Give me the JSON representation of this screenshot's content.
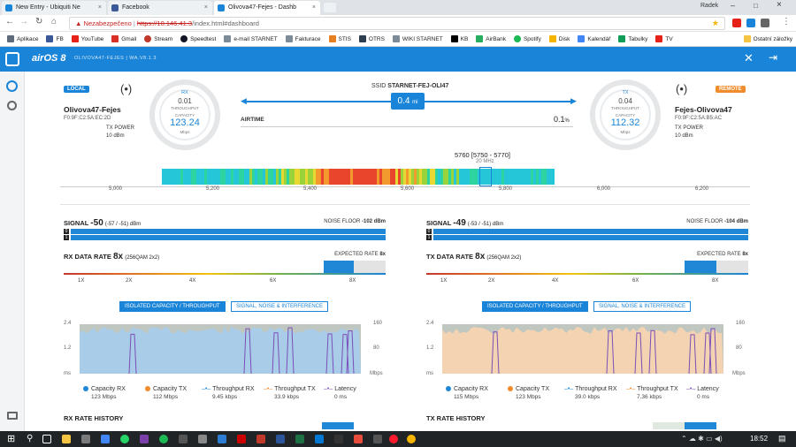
{
  "browser": {
    "user": "Radek",
    "tabs": [
      {
        "title": "New Entry - Ubiquiti Ne",
        "color": "#1a85d8"
      },
      {
        "title": "Facebook",
        "color": "#3b5998"
      },
      {
        "title": "Olivova47-Fejes - Dashb",
        "color": "#1a85d8"
      }
    ],
    "security": "Nezabezpečeno",
    "url_host": "https://10.146.41.3",
    "url_path": "/index.html#dashboard",
    "bookmarks": [
      {
        "label": "Aplikace",
        "color": "#5f6b7a"
      },
      {
        "label": "FB",
        "color": "#3b5998"
      },
      {
        "label": "YouTube",
        "color": "#e62117"
      },
      {
        "label": "Gmail",
        "color": "#d93025"
      },
      {
        "label": "Stream",
        "color": "#c0392b"
      },
      {
        "label": "Speedtest",
        "color": "#141526"
      },
      {
        "label": "e-mail STARNET",
        "color": "#7d8b99"
      },
      {
        "label": "Fakturace",
        "color": "#7d8b99"
      },
      {
        "label": "STIS",
        "color": "#e67e22"
      },
      {
        "label": "OTRS",
        "color": "#2c3e50"
      },
      {
        "label": "WIKI STARNET",
        "color": "#7d8b99"
      },
      {
        "label": "KB",
        "color": "#000000"
      },
      {
        "label": "AirBank",
        "color": "#27ae60"
      },
      {
        "label": "Spotify",
        "color": "#1db954"
      },
      {
        "label": "Disk",
        "color": "#f4b400"
      },
      {
        "label": "Kalendář",
        "color": "#4285f4"
      },
      {
        "label": "Tabulky",
        "color": "#0f9d58"
      },
      {
        "label": "TV",
        "color": "#e62117"
      }
    ],
    "other_bookmarks": "Ostatní záložky"
  },
  "airos": {
    "logo": "airOS 8",
    "device": "OLIVOVA47-FEJES | WA.V8.1.3"
  },
  "local": {
    "badge": "LOCAL",
    "name": "Olivova47-Fejes",
    "mac": "F0:9F:C2:5A:EC:2D",
    "txpower_label": "TX POWER",
    "txpower": "10 dBm",
    "gauge_label": "RX",
    "throughput": "0.01",
    "throughput_label": "THROUGHPUT",
    "capacity_label": "CAPACITY",
    "capacity": "123.24",
    "unit": "Mbps"
  },
  "remote": {
    "badge": "REMOTE",
    "name": "Fejes-Olivova47",
    "mac": "F0:9F:C2:5A:B5:AC",
    "txpower_label": "TX POWER",
    "txpower": "10 dBm",
    "gauge_label": "TX",
    "throughput": "0.04",
    "throughput_label": "THROUGHPUT",
    "capacity_label": "CAPACITY",
    "capacity": "112.32",
    "unit": "Mbps"
  },
  "link": {
    "ssid_label": "SSID",
    "ssid": "STARNET-FEJ-OLI47",
    "distance": "0.4",
    "distance_unit": "mi",
    "airtime_label": "AIRTIME",
    "airtime": "0.1",
    "airtime_unit": "%"
  },
  "spectrum": {
    "frequency": "5760 [5750 - 5770]",
    "width": "20 MHz",
    "ticks": [
      "5,000",
      "5,200",
      "5,400",
      "5,600",
      "5,800",
      "6,000",
      "6,200"
    ]
  },
  "left_panel": {
    "signal_label": "SIGNAL",
    "signal": "-50",
    "signal_detail": "(-57 / -51) dBm",
    "noise_label": "NOISE FLOOR",
    "noise": "-102 dBm",
    "chain0": "0",
    "chain1": "1",
    "rate_label": "RX DATA RATE",
    "rate": "8x",
    "rate_detail": "(256QAM 2x2)",
    "expected_label": "EXPECTED RATE",
    "expected": "8x",
    "rate_ticks": [
      "1X",
      "2X",
      "4X",
      "6X",
      "8X"
    ],
    "tab_active": "ISOLATED CAPACITY / THROUGHPUT",
    "tab_inactive": "SIGNAL, NOISE & INTERFERENCE",
    "y_left": [
      "2.4",
      "1.2",
      "ms"
    ],
    "y_right": [
      "160",
      "80",
      "Mbps"
    ],
    "legend": [
      {
        "label": "Capacity RX",
        "value": "123 Mbps",
        "color": "#1f87d6"
      },
      {
        "label": "Capacity TX",
        "value": "112 Mbps",
        "color": "#f08c2c"
      },
      {
        "label": "Throughput RX",
        "value": "9.45 kbps",
        "color": "#1f87d6"
      },
      {
        "label": "Throughput TX",
        "value": "33.9 kbps",
        "color": "#f08c2c"
      },
      {
        "label": "Latency",
        "value": "0 ms",
        "color": "#7b4fb8"
      }
    ],
    "history_label": "RX RATE HISTORY"
  },
  "right_panel": {
    "signal_label": "SIGNAL",
    "signal": "-49",
    "signal_detail": "(-53 / -51) dBm",
    "noise_label": "NOISE FLOOR",
    "noise": "-104 dBm",
    "chain0": "0",
    "chain1": "1",
    "rate_label": "TX DATA RATE",
    "rate": "8x",
    "rate_detail": "(256QAM 2x2)",
    "expected_label": "EXPECTED RATE",
    "expected": "8x",
    "rate_ticks": [
      "1X",
      "2X",
      "4X",
      "6X",
      "8X"
    ],
    "tab_active": "ISOLATED CAPACITY / THROUGHPUT",
    "tab_inactive": "SIGNAL, NOISE & INTERFERENCE",
    "y_left": [
      "2.4",
      "1.2",
      "ms"
    ],
    "y_right": [
      "160",
      "80",
      "Mbps"
    ],
    "legend": [
      {
        "label": "Capacity RX",
        "value": "115 Mbps",
        "color": "#1f87d6"
      },
      {
        "label": "Capacity TX",
        "value": "123 Mbps",
        "color": "#f08c2c"
      },
      {
        "label": "Throughput RX",
        "value": "39.0 kbps",
        "color": "#1f87d6"
      },
      {
        "label": "Throughput TX",
        "value": "7.36 kbps",
        "color": "#f08c2c"
      },
      {
        "label": "Latency",
        "value": "0 ms",
        "color": "#7b4fb8"
      }
    ],
    "history_label": "TX RATE HISTORY"
  },
  "taskbar": {
    "clock": "18:52"
  }
}
